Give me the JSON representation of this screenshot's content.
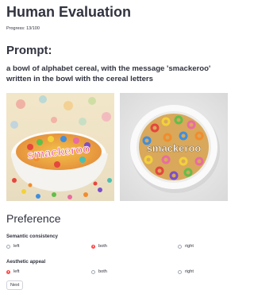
{
  "header": {
    "title": "Human Evaluation",
    "progress": "Progress: 13/100"
  },
  "prompt": {
    "heading": "Prompt:",
    "text": "a bowl of alphabet cereal, with the message 'smackeroo' written in the bowl with the cereal letters"
  },
  "images": [
    {
      "bowl_text": "smackeroo"
    },
    {
      "bowl_text": "smackeroo"
    }
  ],
  "preference": {
    "heading": "Preference",
    "questions": [
      {
        "label": "Semantic consistency",
        "options": [
          "left",
          "both",
          "right"
        ],
        "selected": "both"
      },
      {
        "label": "Aesthetic appeal",
        "options": [
          "left",
          "both",
          "right"
        ],
        "selected": "left"
      }
    ],
    "next_label": "Next"
  },
  "colors": {
    "accent": "#ff4b4b",
    "text": "#31333f"
  }
}
